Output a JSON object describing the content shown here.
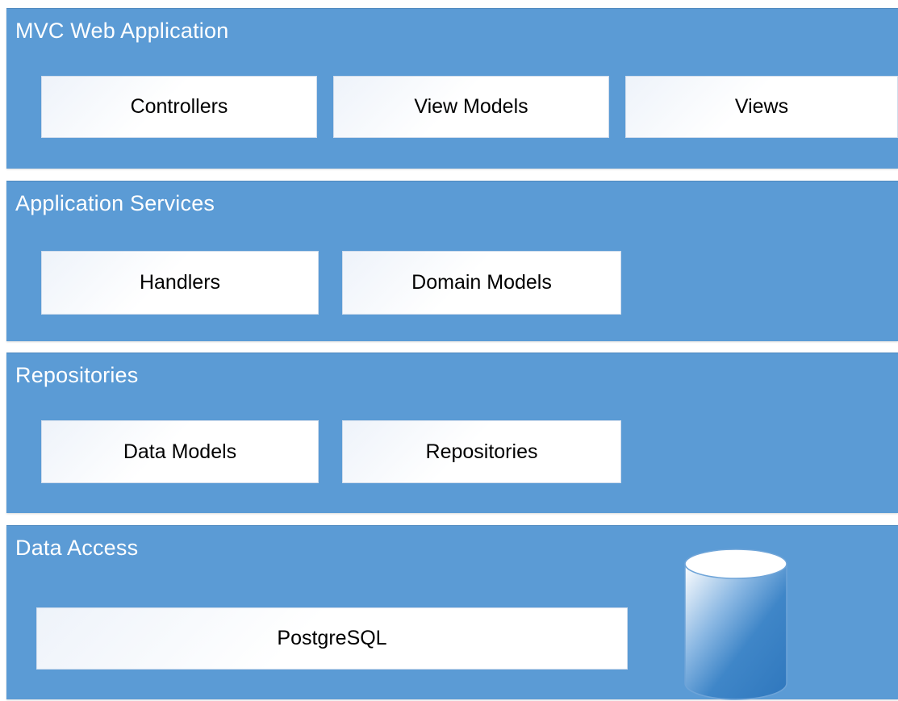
{
  "layers": [
    {
      "title": "MVC Web Application",
      "components": [
        "Controllers",
        "View Models",
        "Views"
      ]
    },
    {
      "title": "Application Services",
      "components": [
        "Handlers",
        "Domain Models"
      ]
    },
    {
      "title": "Repositories",
      "components": [
        "Data Models",
        "Repositories"
      ]
    },
    {
      "title": "Data Access",
      "components": [
        "PostgreSQL"
      ]
    }
  ],
  "colors": {
    "layer_fill": "#5b9bd5",
    "box_fill": "#ffffff",
    "database_fill": "#3d84c6"
  },
  "icons": [
    "database-icon"
  ]
}
